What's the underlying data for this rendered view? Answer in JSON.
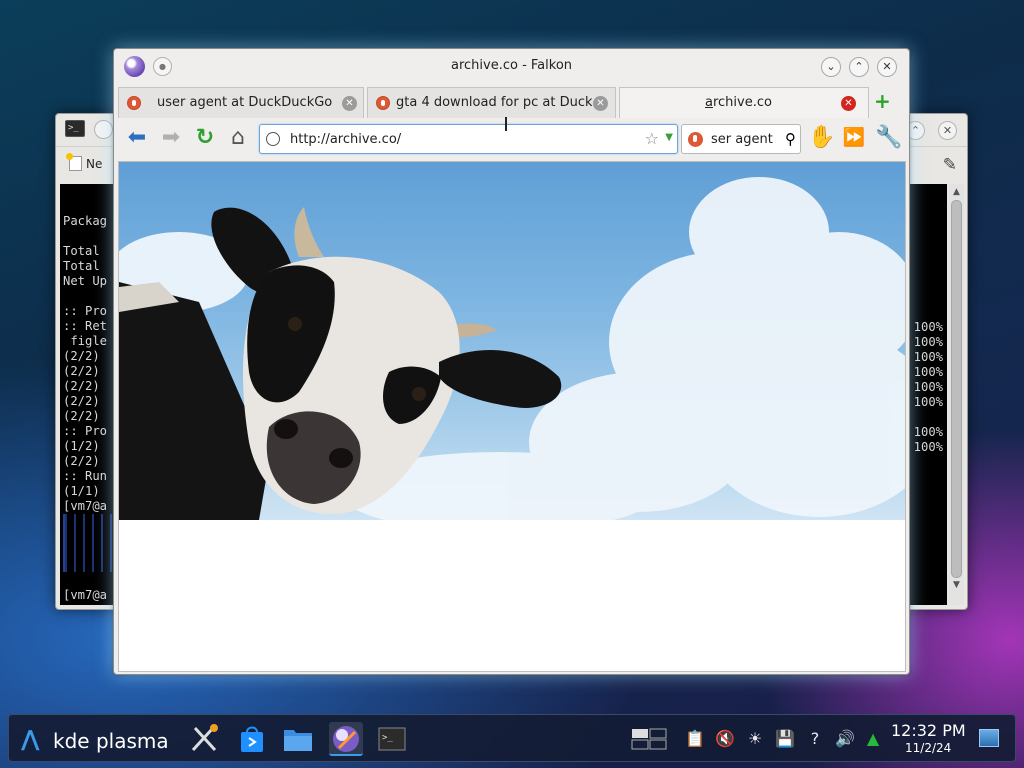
{
  "terminal": {
    "toolbar_new": "Ne",
    "lines": [
      "",
      "Packag",
      "",
      "Total",
      "Total",
      "Net Up",
      "",
      ":: Pro",
      ":: Ret",
      " figle",
      "(2/2)",
      "(2/2)",
      "(2/2)",
      "(2/2)",
      "(2/2)",
      ":: Pro",
      "(1/2)",
      "(2/2)",
      ":: Run",
      "(1/1)",
      "[vm7@a"
    ],
    "percent_column": [
      "100%",
      "100%",
      "100%",
      "100%",
      "100%",
      "100%",
      "",
      "100%",
      "100%"
    ],
    "bottom_prompt": "[vm7@a"
  },
  "browser": {
    "window_title": "archive.co - Falkon",
    "tabs": [
      {
        "label": "user agent at DuckDuckGo"
      },
      {
        "label": "gta 4 download for pc at Duck..."
      },
      {
        "label": "archive.co"
      }
    ],
    "url": "http://archive.co/",
    "search_query": "ser agent"
  },
  "taskbar": {
    "launcher_label": "kde plasma",
    "clock_time": "12:32 PM",
    "clock_date": "11/2/24"
  },
  "colors": {
    "accent": "#3a9be8",
    "duckduckgo": "#de5833",
    "tab_close_active": "#d2261f"
  }
}
